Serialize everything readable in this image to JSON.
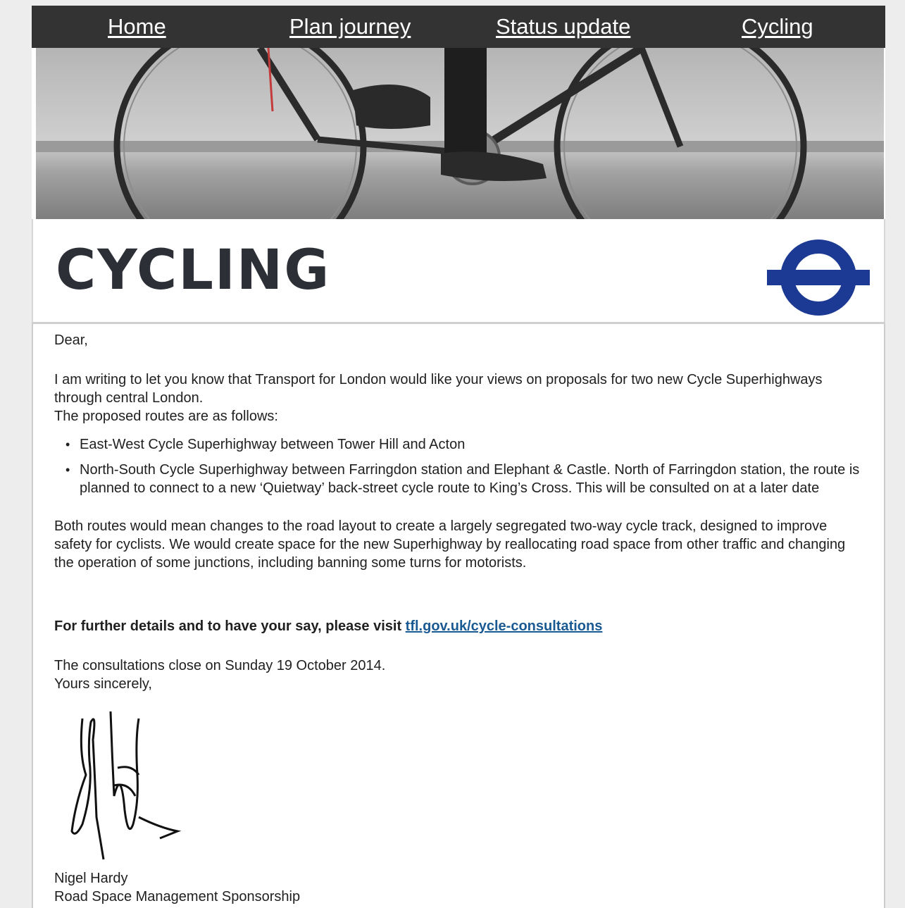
{
  "nav": {
    "items": [
      {
        "label": "Home"
      },
      {
        "label": "Plan journey"
      },
      {
        "label": "Status update"
      },
      {
        "label": "Cycling"
      }
    ]
  },
  "header": {
    "title": "CYCLING",
    "logo": "tfl-roundel-icon"
  },
  "letter": {
    "greeting": "Dear,",
    "intro": "I am writing to let you know that Transport for London would like your views on proposals for two new Cycle Superhighways through central London.",
    "routes_intro": "The proposed routes are as follows:",
    "routes": [
      "East-West Cycle Superhighway between Tower Hill and Acton",
      "North-South Cycle Superhighway between Farringdon station and Elephant & Castle. North of Farringdon station, the route is planned to connect to a new ‘Quietway’ back-street cycle route to King’s Cross. This will be consulted on at a later date"
    ],
    "details": "Both routes would mean changes to the road layout to create a largely segregated two-way cycle track, designed to improve safety for cyclists. We would create space for the new Superhighway by reallocating road space from other traffic and changing the operation of some junctions, including banning some turns for motorists.",
    "cta_text": "For further details and to have your say, please visit ",
    "cta_link": "tfl.gov.uk/cycle-consultations",
    "closing_date": "The consultations close on Sunday 19 October 2014.",
    "signoff": "Yours sincerely,",
    "signature": "handwritten-signature",
    "name": "Nigel Hardy",
    "role": "Road Space Management Sponsorship"
  },
  "colors": {
    "nav_bg": "#333333",
    "link": "#1a5a92",
    "roundel": "#1c3a93"
  }
}
